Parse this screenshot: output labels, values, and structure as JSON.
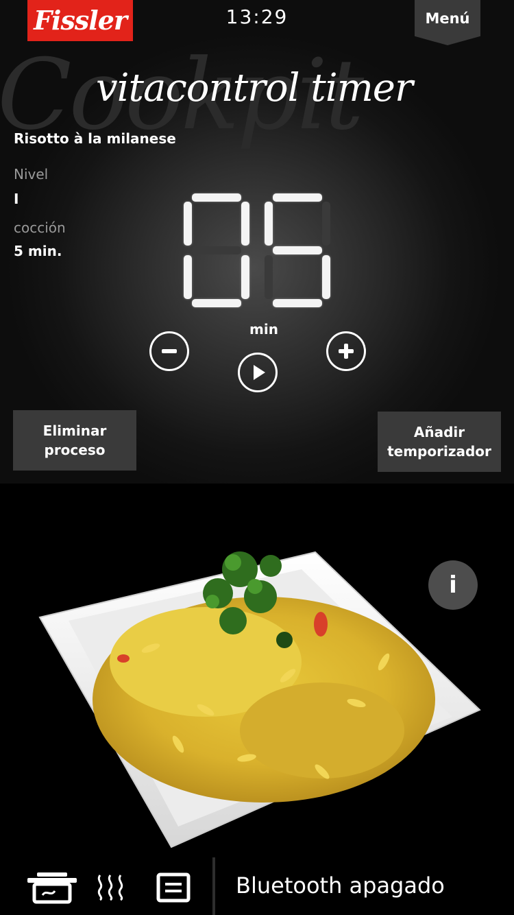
{
  "header": {
    "logo_text": "Fissler",
    "time": "13:29",
    "menu_label": "Menú"
  },
  "title": {
    "watermark": "Cookpit",
    "app_title": "vitacontrol timer"
  },
  "recipe": {
    "name": "Risotto à la milanese",
    "level_label": "Nivel",
    "level_value": "I",
    "cook_label": "cocción",
    "cook_value": "5 min."
  },
  "timer": {
    "digits": "05",
    "unit": "min",
    "decrease_icon": "minus-icon",
    "start_icon": "play-icon",
    "increase_icon": "plus-icon"
  },
  "actions": {
    "delete_label": "Eliminar proceso",
    "add_label": "Añadir temporizador"
  },
  "photo": {
    "info_icon": "info-icon",
    "info_label": "i"
  },
  "bottom": {
    "pot_icon": "pot-icon",
    "steam_icon": "steam-icon",
    "list_icon": "list-icon",
    "bluetooth_status": "Bluetooth apagado"
  },
  "colors": {
    "brand_red": "#e2231a",
    "button_gray": "#3a3a3a",
    "info_gray": "#4d4d4d"
  }
}
